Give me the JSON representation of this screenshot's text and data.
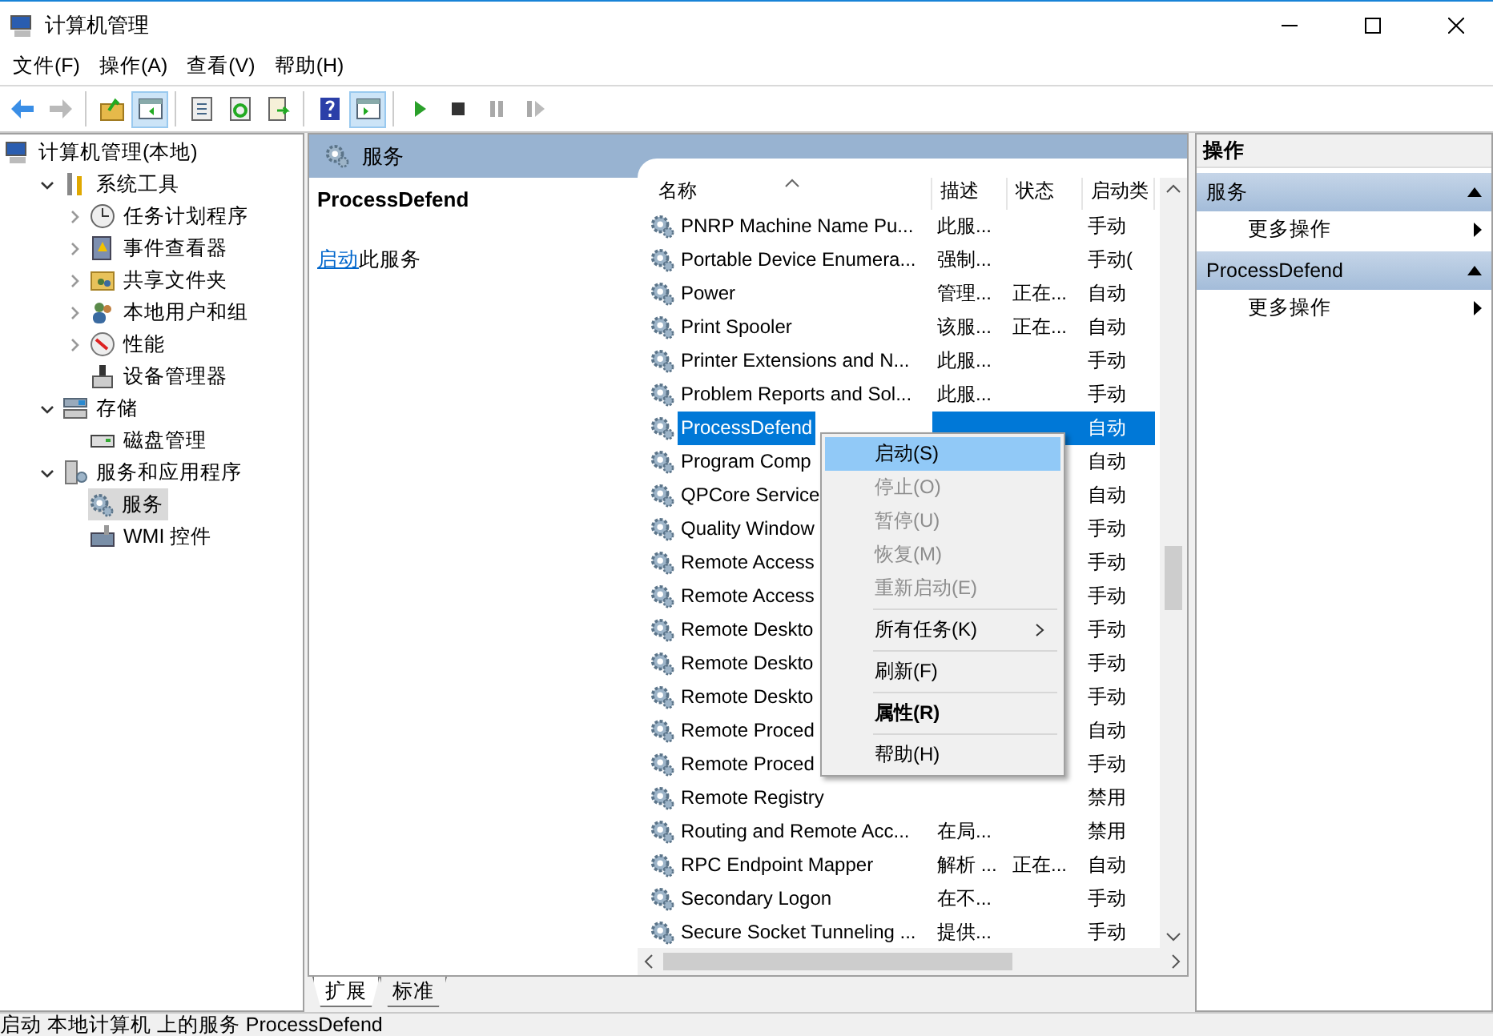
{
  "window": {
    "title": "计算机管理"
  },
  "menu": [
    "文件(F)",
    "操作(A)",
    "查看(V)",
    "帮助(H)"
  ],
  "toolbar": [
    {
      "pressed": false,
      "disabled": false
    },
    {
      "pressed": false,
      "disabled": true
    },
    {
      "pressed": false,
      "disabled": false
    },
    {
      "pressed": true,
      "disabled": false
    },
    {
      "pressed": false,
      "disabled": false
    },
    {
      "pressed": false,
      "disabled": false
    },
    {
      "pressed": false,
      "disabled": false
    },
    {
      "pressed": false,
      "disabled": false
    },
    {
      "pressed": true,
      "disabled": false
    },
    {
      "pressed": false,
      "disabled": false
    },
    {
      "pressed": false,
      "disabled": false
    },
    {
      "pressed": false,
      "disabled": true
    },
    {
      "pressed": false,
      "disabled": true
    }
  ],
  "tree": [
    {
      "label": "计算机管理(本地)",
      "selected": false,
      "children": [
        {
          "label": "系统工具",
          "selected": false,
          "expanded": true,
          "children": [
            {
              "label": "任务计划程序",
              "selected": false,
              "expanded": false
            },
            {
              "label": "事件查看器",
              "selected": false,
              "expanded": false
            },
            {
              "label": "共享文件夹",
              "selected": false,
              "expanded": false
            },
            {
              "label": "本地用户和组",
              "selected": false,
              "expanded": false
            },
            {
              "label": "性能",
              "selected": false,
              "expanded": false
            },
            {
              "label": "设备管理器",
              "selected": false
            }
          ]
        },
        {
          "label": "存储",
          "selected": false,
          "expanded": true,
          "children": [
            {
              "label": "磁盘管理",
              "selected": false
            }
          ]
        },
        {
          "label": "服务和应用程序",
          "selected": false,
          "expanded": true,
          "children": [
            {
              "label": "服务",
              "selected": true
            },
            {
              "label": "WMI 控件",
              "selected": false
            }
          ]
        }
      ]
    }
  ],
  "services": {
    "title": "服务",
    "detail": {
      "name": "ProcessDefend",
      "link": "启动",
      "text": "此服务"
    },
    "columns": [
      {
        "label": "名称",
        "sorted": true
      },
      {
        "label": "描述",
        "sorted": false
      },
      {
        "label": "状态",
        "sorted": false
      },
      {
        "label": "启动类",
        "sorted": false
      }
    ],
    "rows": [
      {
        "name": "PNRP Machine Name Pu...",
        "description": "此服...",
        "startup": "手动",
        "selected": false
      },
      {
        "name": "Portable Device Enumera...",
        "description": "强制...",
        "startup": "手动(",
        "selected": false
      },
      {
        "name": "Power",
        "description": "管理...",
        "status": "正在...",
        "startup": "自动",
        "selected": false
      },
      {
        "name": "Print Spooler",
        "description": "该服...",
        "status": "正在...",
        "startup": "自动",
        "selected": false
      },
      {
        "name": "Printer Extensions and N...",
        "description": "此服...",
        "startup": "手动",
        "selected": false
      },
      {
        "name": "Problem Reports and Sol...",
        "description": "此服...",
        "startup": "手动",
        "selected": false
      },
      {
        "name": "ProcessDefend",
        "startup": "自动",
        "selected": true
      },
      {
        "name": "Program Comp",
        "startup": "自动",
        "selected": false
      },
      {
        "name": "QPCore Service",
        "startup": "自动",
        "selected": false
      },
      {
        "name": "Quality Window",
        "startup": "手动",
        "selected": false
      },
      {
        "name": "Remote Access",
        "startup": "手动",
        "selected": false
      },
      {
        "name": "Remote Access",
        "startup": "手动",
        "selected": false
      },
      {
        "name": "Remote Deskto",
        "startup": "手动",
        "selected": false
      },
      {
        "name": "Remote Deskto",
        "startup": "手动",
        "selected": false
      },
      {
        "name": "Remote Deskto",
        "startup": "手动",
        "selected": false
      },
      {
        "name": "Remote Proced",
        "startup": "自动",
        "selected": false
      },
      {
        "name": "Remote Proced",
        "startup": "手动",
        "selected": false
      },
      {
        "name": "Remote Registry",
        "startup": "禁用",
        "selected": false
      },
      {
        "name": "Routing and Remote Acc...",
        "description": "在局...",
        "startup": "禁用",
        "selected": false
      },
      {
        "name": "RPC Endpoint Mapper",
        "description": "解析 ...",
        "status": "正在...",
        "startup": "自动",
        "selected": false
      },
      {
        "name": "Secondary Logon",
        "description": "在不...",
        "startup": "手动",
        "selected": false
      },
      {
        "name": "Secure Socket Tunneling ...",
        "description": "提供...",
        "startup": "手动",
        "selected": false
      }
    ],
    "tabs": [
      {
        "label": "扩展",
        "selected": true
      },
      {
        "label": "标准",
        "selected": false
      }
    ]
  },
  "context_menu": [
    {
      "kind": "item",
      "label": "启动(S)",
      "selected": true,
      "disabled": false
    },
    {
      "kind": "item",
      "label": "停止(O)",
      "selected": false,
      "disabled": true
    },
    {
      "kind": "item",
      "label": "暂停(U)",
      "selected": false,
      "disabled": true
    },
    {
      "kind": "item",
      "label": "恢复(M)",
      "selected": false,
      "disabled": true
    },
    {
      "kind": "item",
      "label": "重新启动(E)",
      "selected": false,
      "disabled": true
    },
    {
      "kind": "separator"
    },
    {
      "kind": "submenu",
      "label": "所有任务(K)",
      "selected": false,
      "disabled": false
    },
    {
      "kind": "separator"
    },
    {
      "kind": "item",
      "label": "刷新(F)",
      "selected": false,
      "disabled": false
    },
    {
      "kind": "separator"
    },
    {
      "kind": "default",
      "label": "属性(R)",
      "selected": false,
      "disabled": false
    },
    {
      "kind": "separator"
    },
    {
      "kind": "item",
      "label": "帮助(H)",
      "selected": false,
      "disabled": false
    }
  ],
  "actions": {
    "title": "操作",
    "sections": [
      {
        "title": "服务",
        "expanded": true,
        "items": [
          "更多操作"
        ]
      },
      {
        "title": "ProcessDefend",
        "expanded": true,
        "items": [
          "更多操作"
        ]
      }
    ]
  },
  "status_bar": "启动 本地计算机 上的服务 ProcessDefend"
}
